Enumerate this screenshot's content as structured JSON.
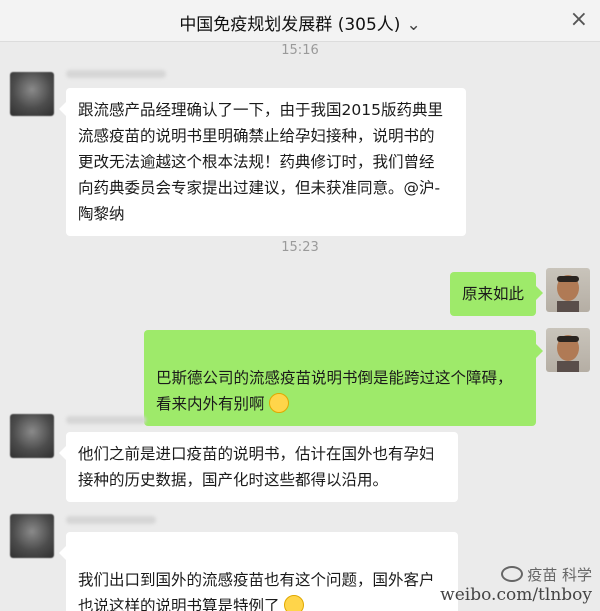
{
  "header": {
    "title": "中国免疫规划发展群 (305人)",
    "chevron_icon": "chevron-down-icon",
    "close_icon": "close-icon"
  },
  "timestamps": [
    "15:16",
    "15:23"
  ],
  "messages": [
    {
      "side": "left",
      "text": "跟流感产品经理确认了一下，由于我国2015版药典里\n流感疫苗的说明书里明确禁止给孕妇接种，说明书的\n更改无法逾越这个根本法规！药典修订时，我们曾经\n向药典委员会专家提出过建议，但未获准同意。@沪-\n陶黎纳"
    },
    {
      "side": "right",
      "text": "原来如此"
    },
    {
      "side": "right",
      "text": "巴斯德公司的流感疫苗说明书倒是能跨过这个障碍，\n看来内外有别啊",
      "emoji": "grimace-emoji-icon"
    },
    {
      "side": "left",
      "text": "他们之前是进口疫苗的说明书，估计在国外也有孕妇\n接种的历史数据，国产化时这些都得以沿用。"
    },
    {
      "side": "left",
      "text": "我们出口到国外的流感疫苗也有这个问题，国外客户\n也说这样的说明书算是特例了",
      "emoji": "squint-laugh-emoji-icon"
    }
  ],
  "watermark": {
    "line1": "疫苗 科学",
    "line2": "weibo.com/tlnboy"
  },
  "colors": {
    "background": "#ebebeb",
    "left_bubble": "#ffffff",
    "right_bubble": "#9eea6a"
  }
}
